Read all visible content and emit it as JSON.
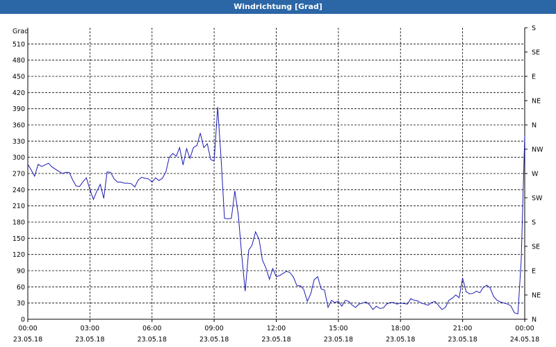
{
  "window": {
    "title": "Windrichtung [Grad]"
  },
  "colors": {
    "titlebar": "#2b66a6",
    "line": "#1a1ab4",
    "grid": "#000000"
  },
  "chart_data": {
    "type": "line",
    "title": "Windrichtung [Grad]",
    "ylabel": "Grad",
    "xlabel": "",
    "ylim": [
      0,
      540
    ],
    "xlim_hours": [
      0,
      24
    ],
    "grid": true,
    "y_ticks": [
      0,
      30,
      60,
      90,
      120,
      150,
      180,
      210,
      240,
      270,
      300,
      330,
      360,
      390,
      420,
      450,
      480,
      510
    ],
    "y_right_ticks": [
      {
        "value": 0,
        "label": "N"
      },
      {
        "value": 45,
        "label": "NE"
      },
      {
        "value": 90,
        "label": "E"
      },
      {
        "value": 135,
        "label": "SE"
      },
      {
        "value": 180,
        "label": "S"
      },
      {
        "value": 225,
        "label": "SW"
      },
      {
        "value": 270,
        "label": "W"
      },
      {
        "value": 315,
        "label": "NW"
      },
      {
        "value": 360,
        "label": "N"
      },
      {
        "value": 405,
        "label": "NE"
      },
      {
        "value": 450,
        "label": "E"
      },
      {
        "value": 495,
        "label": "SE"
      },
      {
        "value": 540,
        "label": "S"
      }
    ],
    "x_ticks": [
      {
        "h": 0,
        "time": "00:00",
        "date": "23.05.18"
      },
      {
        "h": 3,
        "time": "03:00",
        "date": "23.05.18"
      },
      {
        "h": 6,
        "time": "06:00",
        "date": "23.05.18"
      },
      {
        "h": 9,
        "time": "09:00",
        "date": "23.05.18"
      },
      {
        "h": 12,
        "time": "12:00",
        "date": "23.05.18"
      },
      {
        "h": 15,
        "time": "15:00",
        "date": "23.05.18"
      },
      {
        "h": 18,
        "time": "18:00",
        "date": "23.05.18"
      },
      {
        "h": 21,
        "time": "21:00",
        "date": "23.05.18"
      },
      {
        "h": 24,
        "time": "00:00",
        "date": "24.05.18"
      }
    ],
    "series": [
      {
        "x": [
          0,
          0.17,
          0.33,
          0.5,
          0.67,
          1.0,
          1.17,
          1.5,
          1.67,
          1.83,
          2.0,
          2.17,
          2.33,
          2.5,
          2.67,
          2.83,
          3.0,
          3.17,
          3.33,
          3.5,
          3.67,
          3.83,
          4.0,
          4.17,
          4.33,
          4.5,
          4.67,
          4.83,
          5.0,
          5.17,
          5.33,
          5.5,
          5.67,
          5.83,
          6.0,
          6.17,
          6.33,
          6.5,
          6.67,
          6.83,
          7.0,
          7.17,
          7.33,
          7.5,
          7.67,
          7.83,
          8.0,
          8.17,
          8.33,
          8.5,
          8.67,
          8.83,
          9.0,
          9.17,
          9.33,
          9.5,
          9.67,
          9.83,
          10.0,
          10.17,
          10.33,
          10.5,
          10.67,
          10.83,
          11.0,
          11.17,
          11.33,
          11.5,
          11.67,
          11.83,
          12.0,
          12.17,
          12.33,
          12.5,
          12.67,
          12.83,
          13.0,
          13.17,
          13.33,
          13.5,
          13.67,
          13.83,
          14.0,
          14.17,
          14.33,
          14.5,
          14.67,
          14.83,
          15.0,
          15.17,
          15.33,
          15.5,
          15.67,
          15.83,
          16.0,
          16.17,
          16.33,
          16.5,
          16.67,
          16.83,
          17.0,
          17.17,
          17.33,
          17.5,
          17.67,
          17.83,
          18.0,
          18.17,
          18.33,
          18.5,
          18.67,
          18.83,
          19.0,
          19.17,
          19.33,
          19.5,
          19.67,
          19.83,
          20.0,
          20.17,
          20.33,
          20.5,
          20.67,
          20.83,
          21.0,
          21.17,
          21.33,
          21.5,
          21.67,
          21.83,
          22.0,
          22.17,
          22.33,
          22.5,
          22.67,
          22.83,
          23.0,
          23.17,
          23.33,
          23.5,
          23.67,
          23.83,
          24.0
        ],
        "values": [
          287,
          276,
          265,
          287,
          283,
          289,
          282,
          274,
          270,
          272,
          272,
          258,
          247,
          246,
          255,
          262,
          240,
          222,
          237,
          250,
          224,
          273,
          272,
          260,
          254,
          254,
          252,
          252,
          251,
          245,
          258,
          263,
          261,
          260,
          254,
          262,
          257,
          261,
          273,
          300,
          307,
          302,
          318,
          286,
          316,
          298,
          318,
          322,
          345,
          318,
          325,
          296,
          293,
          393,
          300,
          187,
          186,
          187,
          238,
          192,
          120,
          52,
          128,
          137,
          162,
          148,
          110,
          95,
          74,
          94,
          79,
          81,
          85,
          89,
          86,
          78,
          62,
          62,
          55,
          33,
          48,
          73,
          79,
          56,
          54,
          22,
          35,
          31,
          33,
          24,
          35,
          33,
          26,
          22,
          28,
          30,
          32,
          27,
          18,
          24,
          20,
          21,
          28,
          31,
          31,
          28,
          30,
          29,
          28,
          38,
          35,
          34,
          30,
          28,
          26,
          31,
          33,
          26,
          18,
          22,
          35,
          39,
          45,
          40,
          76,
          51,
          47,
          48,
          52,
          49,
          59,
          63,
          58,
          42,
          35,
          32,
          30,
          28,
          25,
          12,
          10,
          108,
          340
        ]
      }
    ]
  }
}
